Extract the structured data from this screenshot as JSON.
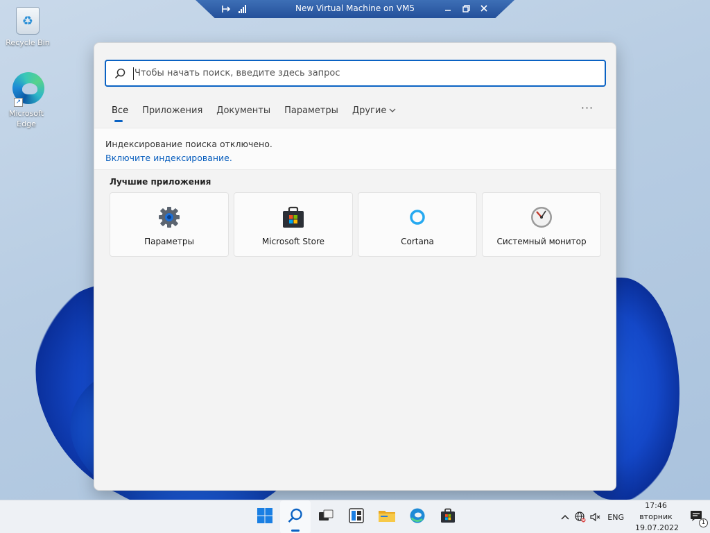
{
  "desktop": {
    "icons": [
      {
        "label": "Recycle Bin",
        "icon": "recycle-bin-icon"
      },
      {
        "label": "Microsoft Edge",
        "icon": "edge-icon"
      }
    ]
  },
  "vm_bar": {
    "title": "New Virtual Machine on VM5",
    "left_icons": [
      "pin-icon",
      "signal-icon"
    ],
    "right_icons": [
      "minimize-icon",
      "restore-icon",
      "close-icon"
    ]
  },
  "search": {
    "placeholder": "Чтобы начать поиск, введите здесь запрос",
    "value": "",
    "tabs": [
      {
        "label": "Все",
        "active": true
      },
      {
        "label": "Приложения"
      },
      {
        "label": "Документы"
      },
      {
        "label": "Параметры"
      },
      {
        "label": "Другие",
        "has_dropdown": true
      }
    ],
    "more_label": "···",
    "notice": {
      "message": "Индексирование поиска отключено.",
      "link": "Включите индексирование."
    },
    "top_apps_title": "Лучшие приложения",
    "top_apps": [
      {
        "label": "Параметры",
        "icon": "settings-gear-icon"
      },
      {
        "label": "Microsoft Store",
        "icon": "store-bag-icon"
      },
      {
        "label": "Cortana",
        "icon": "cortana-ring-icon"
      },
      {
        "label": "Системный монитор",
        "icon": "performance-monitor-icon"
      }
    ]
  },
  "taskbar": {
    "buttons": [
      {
        "name": "start-button",
        "icon": "windows-logo-icon"
      },
      {
        "name": "search-button",
        "icon": "search-icon",
        "active": true
      },
      {
        "name": "task-view-button",
        "icon": "task-view-icon"
      },
      {
        "name": "widgets-button",
        "icon": "widgets-icon"
      },
      {
        "name": "file-explorer-button",
        "icon": "folder-icon"
      },
      {
        "name": "edge-button",
        "icon": "edge-icon"
      },
      {
        "name": "store-button",
        "icon": "store-bag-icon"
      }
    ],
    "tray": {
      "chevron": "^",
      "language": "ENG",
      "time": "17:46",
      "weekday": "вторник",
      "date": "19.07.2022",
      "notification_count": "1"
    }
  },
  "colors": {
    "accent": "#0a62c3",
    "link": "#0a5fbe",
    "vm_bar": "#24509a"
  }
}
